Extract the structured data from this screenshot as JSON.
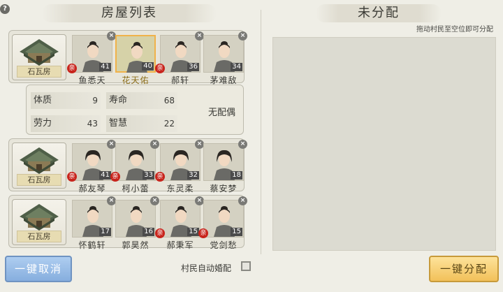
{
  "titles": {
    "left": "房屋列表",
    "right": "未分配"
  },
  "hint": "拖动村民至空位即可分配",
  "houses": [
    {
      "type": "石瓦房",
      "villagers": [
        {
          "name": "鱼悉天",
          "age": "41",
          "kin": true,
          "selected": false
        },
        {
          "name": "花天佑",
          "age": "40",
          "kin": false,
          "selected": true
        },
        {
          "name": "郝轩",
          "age": "36",
          "kin": true,
          "selected": false
        },
        {
          "name": "茅难敌",
          "age": "34",
          "kin": false,
          "selected": false
        }
      ]
    },
    {
      "type": "石瓦房",
      "villagers": [
        {
          "name": "郝友琴",
          "age": "41",
          "kin": true,
          "selected": false
        },
        {
          "name": "柯小蕾",
          "age": "33",
          "kin": true,
          "selected": false
        },
        {
          "name": "东灵柔",
          "age": "32",
          "kin": true,
          "selected": false
        },
        {
          "name": "蔡安梦",
          "age": "18",
          "kin": false,
          "selected": false
        }
      ]
    },
    {
      "type": "石瓦房",
      "villagers": [
        {
          "name": "怀鹤轩",
          "age": "17",
          "kin": false,
          "selected": false
        },
        {
          "name": "郭昊然",
          "age": "16",
          "kin": false,
          "selected": false
        },
        {
          "name": "郝秉军",
          "age": "15",
          "kin": true,
          "selected": false
        },
        {
          "name": "党剑愁",
          "age": "15",
          "kin": true,
          "selected": false
        }
      ]
    }
  ],
  "stats": {
    "constitution_label": "体质",
    "constitution": "9",
    "lifespan_label": "寿命",
    "lifespan": "68",
    "labor_label": "劳力",
    "labor": "43",
    "wisdom_label": "智慧",
    "wisdom": "22",
    "spouse": "无配偶"
  },
  "labels": {
    "kin_mark": "亲",
    "close": "×",
    "help": "?"
  },
  "buttons": {
    "cancel": "一键取消",
    "assign": "一键分配",
    "auto_marry": "村民自动婚配"
  },
  "colors": {
    "kin_badge": "#c8241c",
    "selected_border": "#f0b24a",
    "cancel_button": "#86aede",
    "assign_button": "#f2c15a"
  }
}
